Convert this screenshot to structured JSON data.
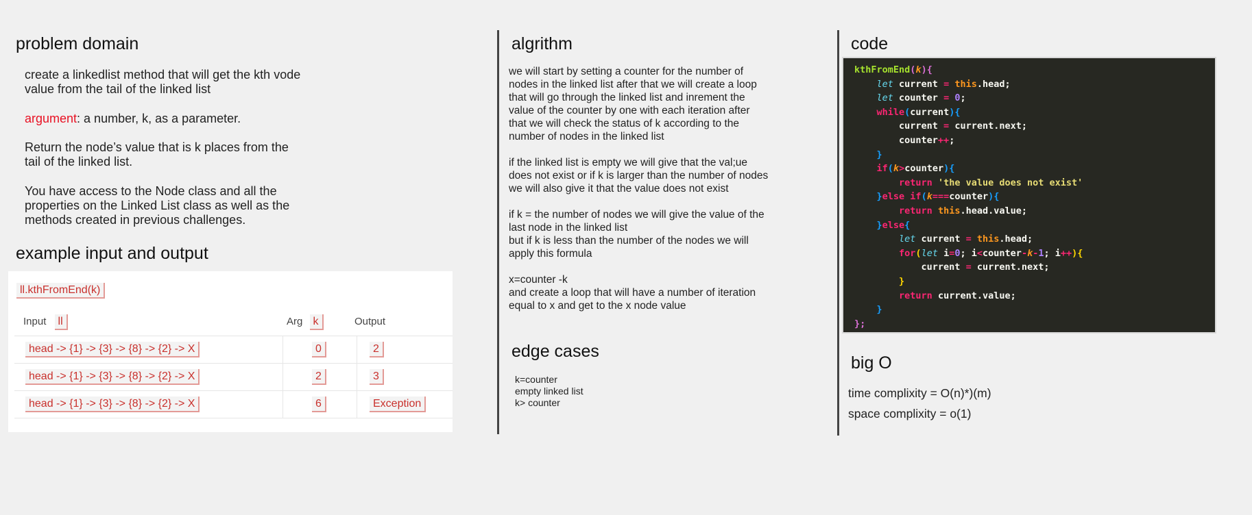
{
  "problem_domain": {
    "heading": "problem domain",
    "description": "create a linkedlist method that will get the kth vode value from the tail of the linked list",
    "argument_label": "argument",
    "argument_text": ": a number, k, as a parameter.",
    "return_text": "Return the node’s value that is k places from the tail of the linked list.",
    "access_text": "You have access to the Node class and all the properties on the Linked List class as well as the methods created in previous challenges."
  },
  "example": {
    "heading": "example input and output",
    "method_badge": "ll.kthFromEnd(k)",
    "header_input": "Input",
    "header_input_badge": "ll",
    "header_arg": "Arg",
    "header_arg_badge": "k",
    "header_output": "Output",
    "rows": [
      {
        "input": "head -> {1} -> {3} -> {8} -> {2} -> X",
        "arg": "0",
        "output": "2"
      },
      {
        "input": "head -> {1} -> {3} -> {8} -> {2} -> X",
        "arg": "2",
        "output": "3"
      },
      {
        "input": "head -> {1} -> {3} -> {8} -> {2} -> X",
        "arg": "6",
        "output": "Exception"
      }
    ]
  },
  "algorithm": {
    "heading": "algrithm",
    "paragraphs": [
      "we will start by setting a counter for the number of nodes in the linked list after that we will create a loop that will go through the linked list and inrement the value of the counter by one with each iteration after that we will check the status of k according to the number of nodes in the linked list",
      "if the linked list is empty we will give that the val;ue does not exist or if k is larger than the number of nodes we will also give it that the value does not exist",
      "if k = the number of nodes we will give the value of the last node in the linked list\nbut if k is less than the number of the nodes we will apply this formula",
      "x=counter -k\nand create a loop that will have a number of iteration equal to x and get to the x node value"
    ]
  },
  "edge_cases": {
    "heading": "edge cases",
    "items": [
      "k=counter",
      "empty linked list",
      "k> counter"
    ]
  },
  "code": {
    "heading": "code",
    "colors": {
      "background": "#272822",
      "function": "#a6e22e",
      "keyword": "#f92672",
      "let": "#66d9ef",
      "string": "#e6db74",
      "number": "#ae81ff",
      "this": "#fd971f"
    },
    "lines": [
      [
        [
          "kthFromEnd",
          "fn"
        ],
        [
          "(",
          "b1"
        ],
        [
          "k",
          "param"
        ],
        [
          "){",
          "b1"
        ]
      ],
      [
        [
          "    ",
          "txt"
        ],
        [
          "let",
          "kwi"
        ],
        [
          " current ",
          "txt"
        ],
        [
          "=",
          "op"
        ],
        [
          " ",
          "txt"
        ],
        [
          "this",
          "this"
        ],
        [
          ".head;",
          "txt"
        ]
      ],
      [
        [
          "    ",
          "txt"
        ],
        [
          "let",
          "kwi"
        ],
        [
          " counter ",
          "txt"
        ],
        [
          "=",
          "op"
        ],
        [
          " ",
          "txt"
        ],
        [
          "0",
          "num"
        ],
        [
          ";",
          "txt"
        ]
      ],
      [
        [
          "    ",
          "txt"
        ],
        [
          "while",
          "kw"
        ],
        [
          "(",
          "b2"
        ],
        [
          "current",
          "txt"
        ],
        [
          "){",
          "b2"
        ]
      ],
      [
        [
          "        current ",
          "txt"
        ],
        [
          "=",
          "op"
        ],
        [
          " current.next;",
          "txt"
        ]
      ],
      [
        [
          "        counter",
          "txt"
        ],
        [
          "++",
          "op"
        ],
        [
          ";",
          "txt"
        ]
      ],
      [
        [
          "    ",
          "txt"
        ],
        [
          "}",
          "b2"
        ]
      ],
      [
        [
          "    ",
          "txt"
        ],
        [
          "if",
          "kw"
        ],
        [
          "(",
          "b2"
        ],
        [
          "k",
          "param"
        ],
        [
          ">",
          "op"
        ],
        [
          "counter",
          "txt"
        ],
        [
          "){",
          "b2"
        ]
      ],
      [
        [
          "        ",
          "txt"
        ],
        [
          "return",
          "kw"
        ],
        [
          " ",
          "txt"
        ],
        [
          "'the value does not exist'",
          "str"
        ]
      ],
      [
        [
          "    ",
          "txt"
        ],
        [
          "}",
          "b2"
        ],
        [
          "else if",
          "kw"
        ],
        [
          "(",
          "b2"
        ],
        [
          "k",
          "param"
        ],
        [
          "===",
          "op"
        ],
        [
          "counter",
          "txt"
        ],
        [
          "){",
          "b2"
        ]
      ],
      [
        [
          "        ",
          "txt"
        ],
        [
          "return",
          "kw"
        ],
        [
          " ",
          "txt"
        ],
        [
          "this",
          "this"
        ],
        [
          ".head.value;",
          "txt"
        ]
      ],
      [
        [
          "    ",
          "txt"
        ],
        [
          "}",
          "b2"
        ],
        [
          "else",
          "kw"
        ],
        [
          "{",
          "b2"
        ]
      ],
      [
        [
          "        ",
          "txt"
        ],
        [
          "let",
          "kwi"
        ],
        [
          " current ",
          "txt"
        ],
        [
          "=",
          "op"
        ],
        [
          " ",
          "txt"
        ],
        [
          "this",
          "this"
        ],
        [
          ".head;",
          "txt"
        ]
      ],
      [
        [
          "        ",
          "txt"
        ],
        [
          "for",
          "kw"
        ],
        [
          "(",
          "b3"
        ],
        [
          "let",
          "kwi"
        ],
        [
          " i",
          "txt"
        ],
        [
          "=",
          "op"
        ],
        [
          "0",
          "num"
        ],
        [
          "; i",
          "txt"
        ],
        [
          "<",
          "op"
        ],
        [
          "counter",
          "txt"
        ],
        [
          "-",
          "op"
        ],
        [
          "k",
          "param"
        ],
        [
          "-",
          "op"
        ],
        [
          "1",
          "num"
        ],
        [
          "; i",
          "txt"
        ],
        [
          "++",
          "op"
        ],
        [
          "){",
          "b3"
        ]
      ],
      [
        [
          "            current ",
          "txt"
        ],
        [
          "=",
          "op"
        ],
        [
          " current.next;",
          "txt"
        ]
      ],
      [
        [
          "        ",
          "txt"
        ],
        [
          "}",
          "b3"
        ]
      ],
      [
        [
          "        ",
          "txt"
        ],
        [
          "return",
          "kw"
        ],
        [
          " current.value;",
          "txt"
        ]
      ],
      [
        [
          "    ",
          "txt"
        ],
        [
          "}",
          "b2"
        ]
      ],
      [
        [
          "};",
          "b1"
        ]
      ]
    ]
  },
  "big_o": {
    "heading": "big O",
    "time": "time complixity = O(n)*)(m)",
    "space": "space complixity = o(1)"
  }
}
